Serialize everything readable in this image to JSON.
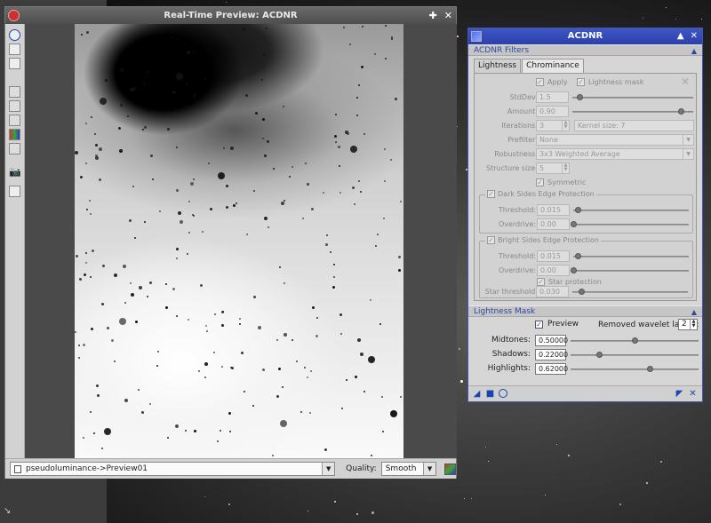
{
  "preview_window": {
    "title": "Real-Time Preview: ACDNR",
    "view_select": "pseudoluminance->Preview01",
    "quality_label": "Quality:",
    "quality_value": "Smooth"
  },
  "acdnr": {
    "title": "ACDNR",
    "filters_section": "ACDNR Filters",
    "tabs": [
      "Lightness",
      "Chrominance"
    ],
    "apply_label": "Apply",
    "lightness_mask_label": "Lightness mask",
    "stddev_label": "StdDev:",
    "stddev_value": "1.5",
    "amount_label": "Amount:",
    "amount_value": "0.90",
    "iterations_label": "Iterations:",
    "iterations_value": "3",
    "kernel_size": "Kernel size: 7",
    "prefilter_label": "Prefilter:",
    "prefilter_value": "None",
    "robustness_label": "Robustness:",
    "robustness_value": "3x3 Weighted Average",
    "structure_label": "Structure size:",
    "structure_value": "5",
    "symmetric_label": "Symmetric",
    "dark_group": "Dark Sides Edge Protection",
    "dark_threshold_label": "Threshold:",
    "dark_threshold_value": "0.015",
    "dark_overdrive_label": "Overdrive:",
    "dark_overdrive_value": "0.00",
    "bright_group": "Bright Sides Edge Protection",
    "bright_threshold_label": "Threshold:",
    "bright_threshold_value": "0.015",
    "bright_overdrive_label": "Overdrive:",
    "bright_overdrive_value": "0.00",
    "star_protection_label": "Star protection",
    "star_threshold_label": "Star threshold:",
    "star_threshold_value": "0.030",
    "mask_section": "Lightness Mask",
    "preview_label": "Preview",
    "wavelet_label": "Removed wavelet layers:",
    "wavelet_value": "2",
    "midtones_label": "Midtones:",
    "midtones_value": "0.50000",
    "shadows_label": "Shadows:",
    "shadows_value": "0.22000",
    "highlights_label": "Highlights:",
    "highlights_value": "0.62000",
    "slider_positions": {
      "stddev": 0.06,
      "amount": 0.9,
      "dark_threshold": 0.04,
      "dark_overdrive": 0.0,
      "bright_threshold": 0.04,
      "bright_overdrive": 0.0,
      "star_threshold": 0.08,
      "midtones": 0.5,
      "shadows": 0.22,
      "highlights": 0.62
    }
  },
  "colors": {
    "acdnr_title": "#2b40a8",
    "section_text": "#2a4aa0",
    "preview_title": "#555555"
  }
}
